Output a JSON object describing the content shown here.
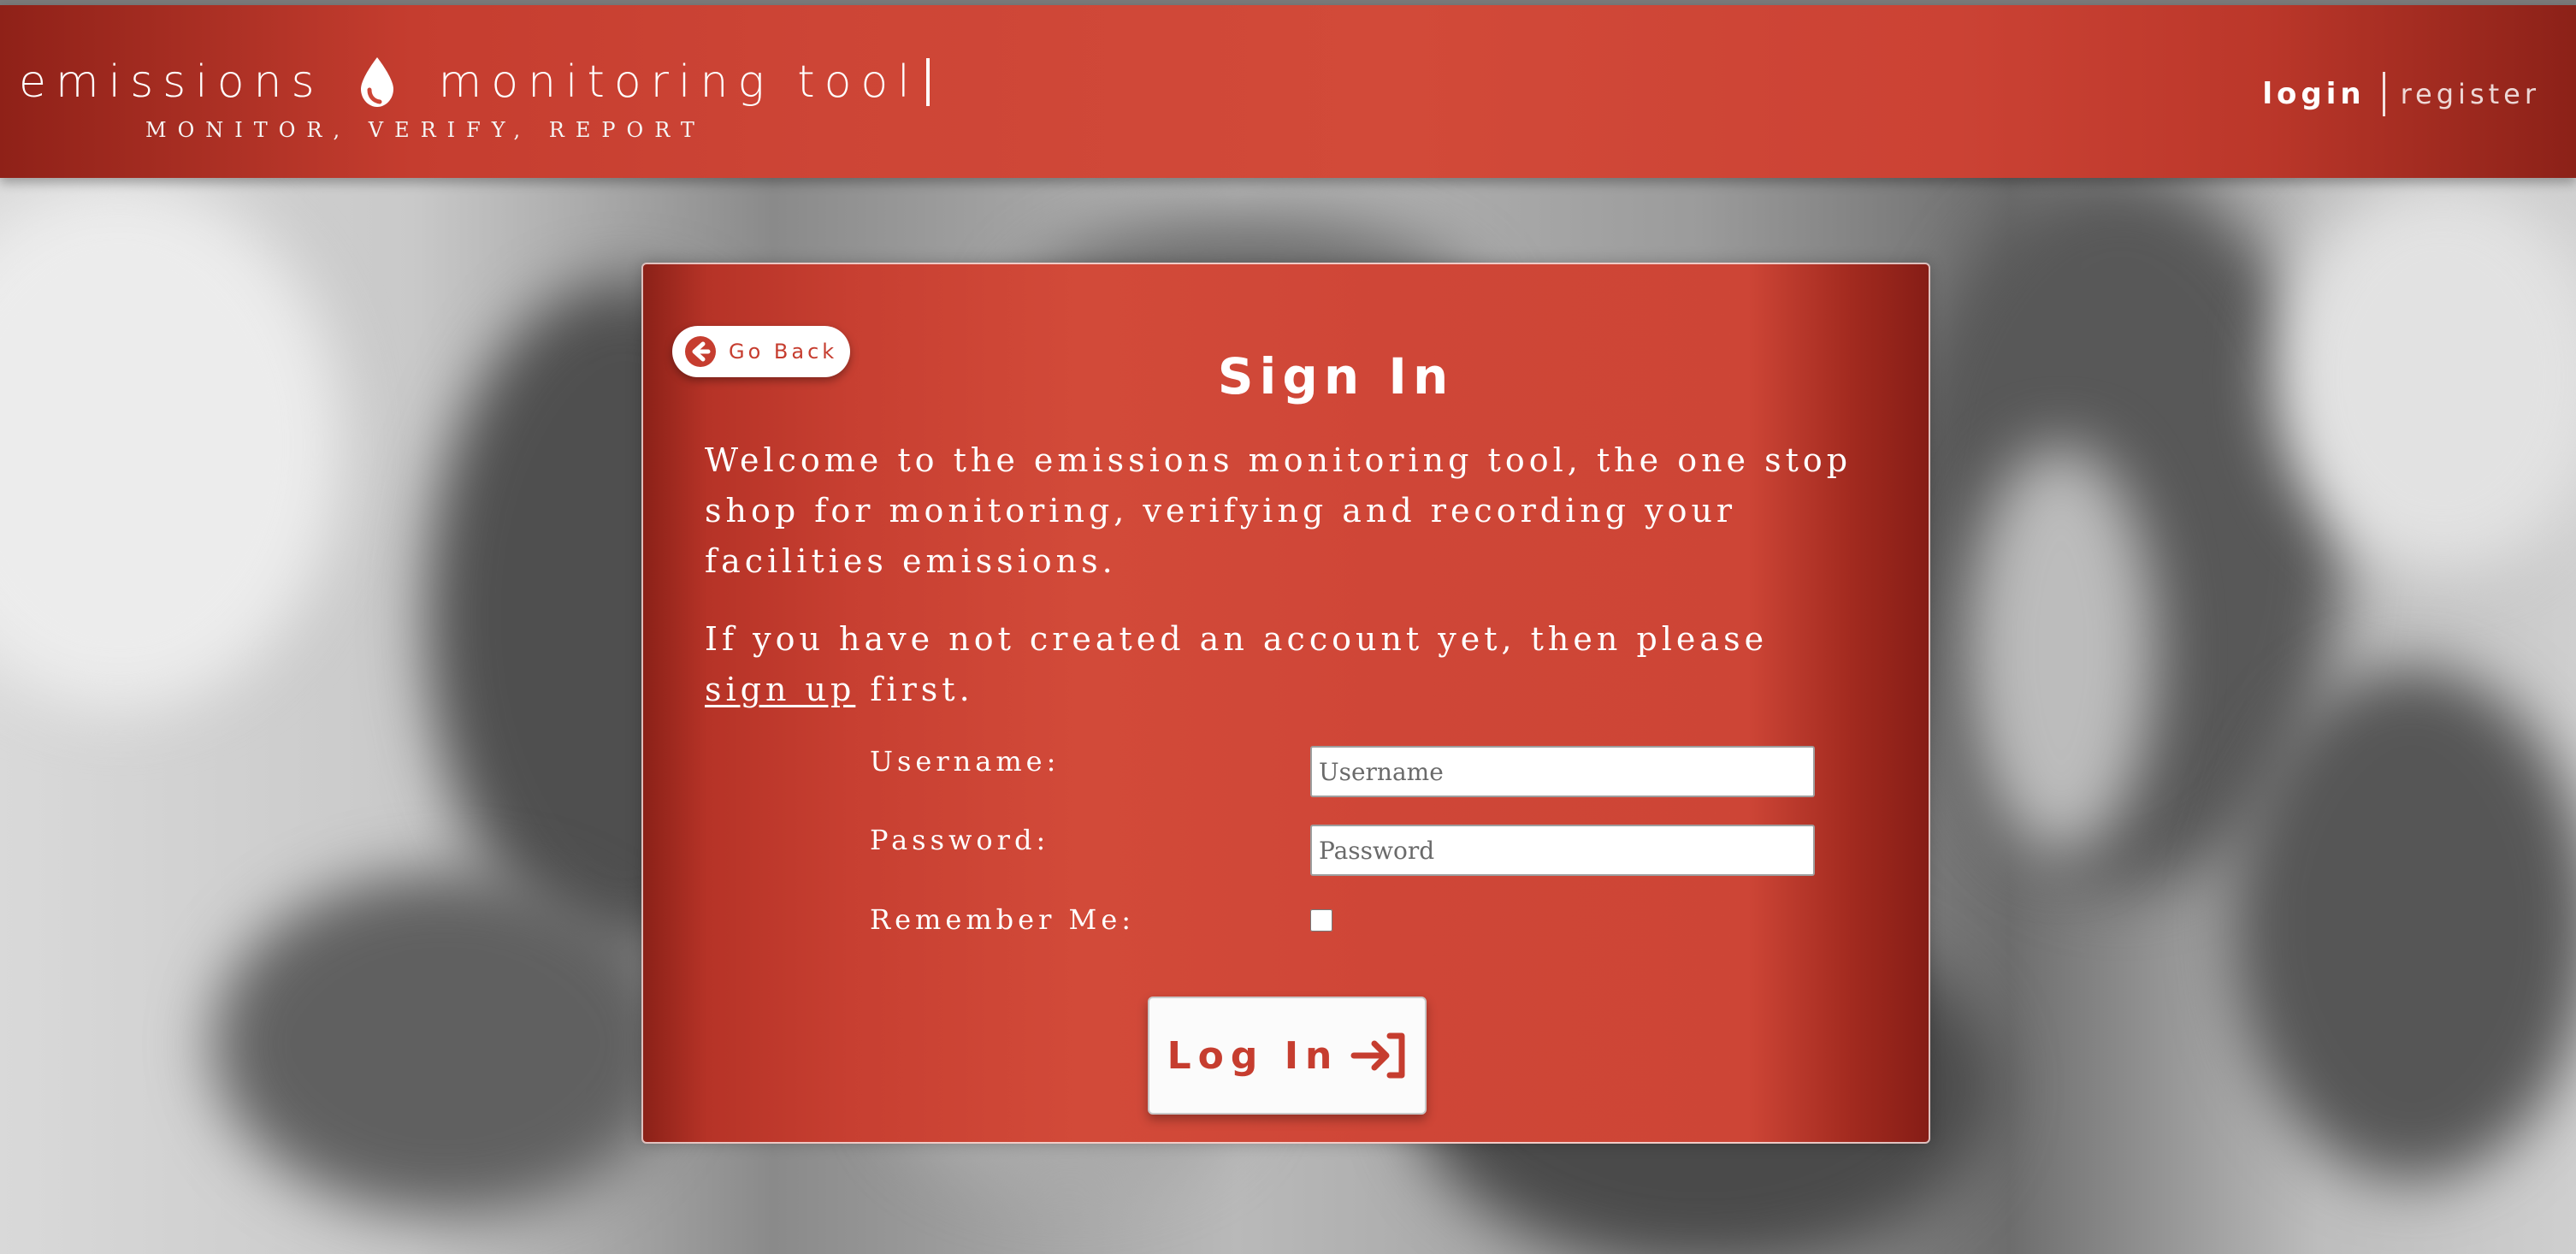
{
  "header": {
    "brand_left": "emissions",
    "brand_right": "monitoring tool",
    "tagline": "MONITOR, VERIFY, REPORT",
    "nav_login": "login",
    "nav_register": "register"
  },
  "card": {
    "go_back_label": "Go Back",
    "title": "Sign In",
    "welcome_text": "Welcome to the emissions monitoring tool, the one stop shop for monitoring, verifying and recording your facilities emissions.",
    "signup_prefix": "If you have not created an account yet, then please ",
    "signup_link": "sign up",
    "signup_suffix": " first."
  },
  "form": {
    "username_label": "Username:",
    "username_placeholder": "Username",
    "password_label": "Password:",
    "password_placeholder": "Password",
    "remember_label": "Remember Me:",
    "login_button": "Log In"
  },
  "icons": {
    "brand_icon": "droplet-icon",
    "go_back_icon": "arrow-left-circle-icon",
    "login_icon": "log-in-arrow-icon"
  },
  "colors": {
    "brand_red": "#cd4536",
    "dark_red": "#8c2118",
    "white": "#ffffff"
  }
}
